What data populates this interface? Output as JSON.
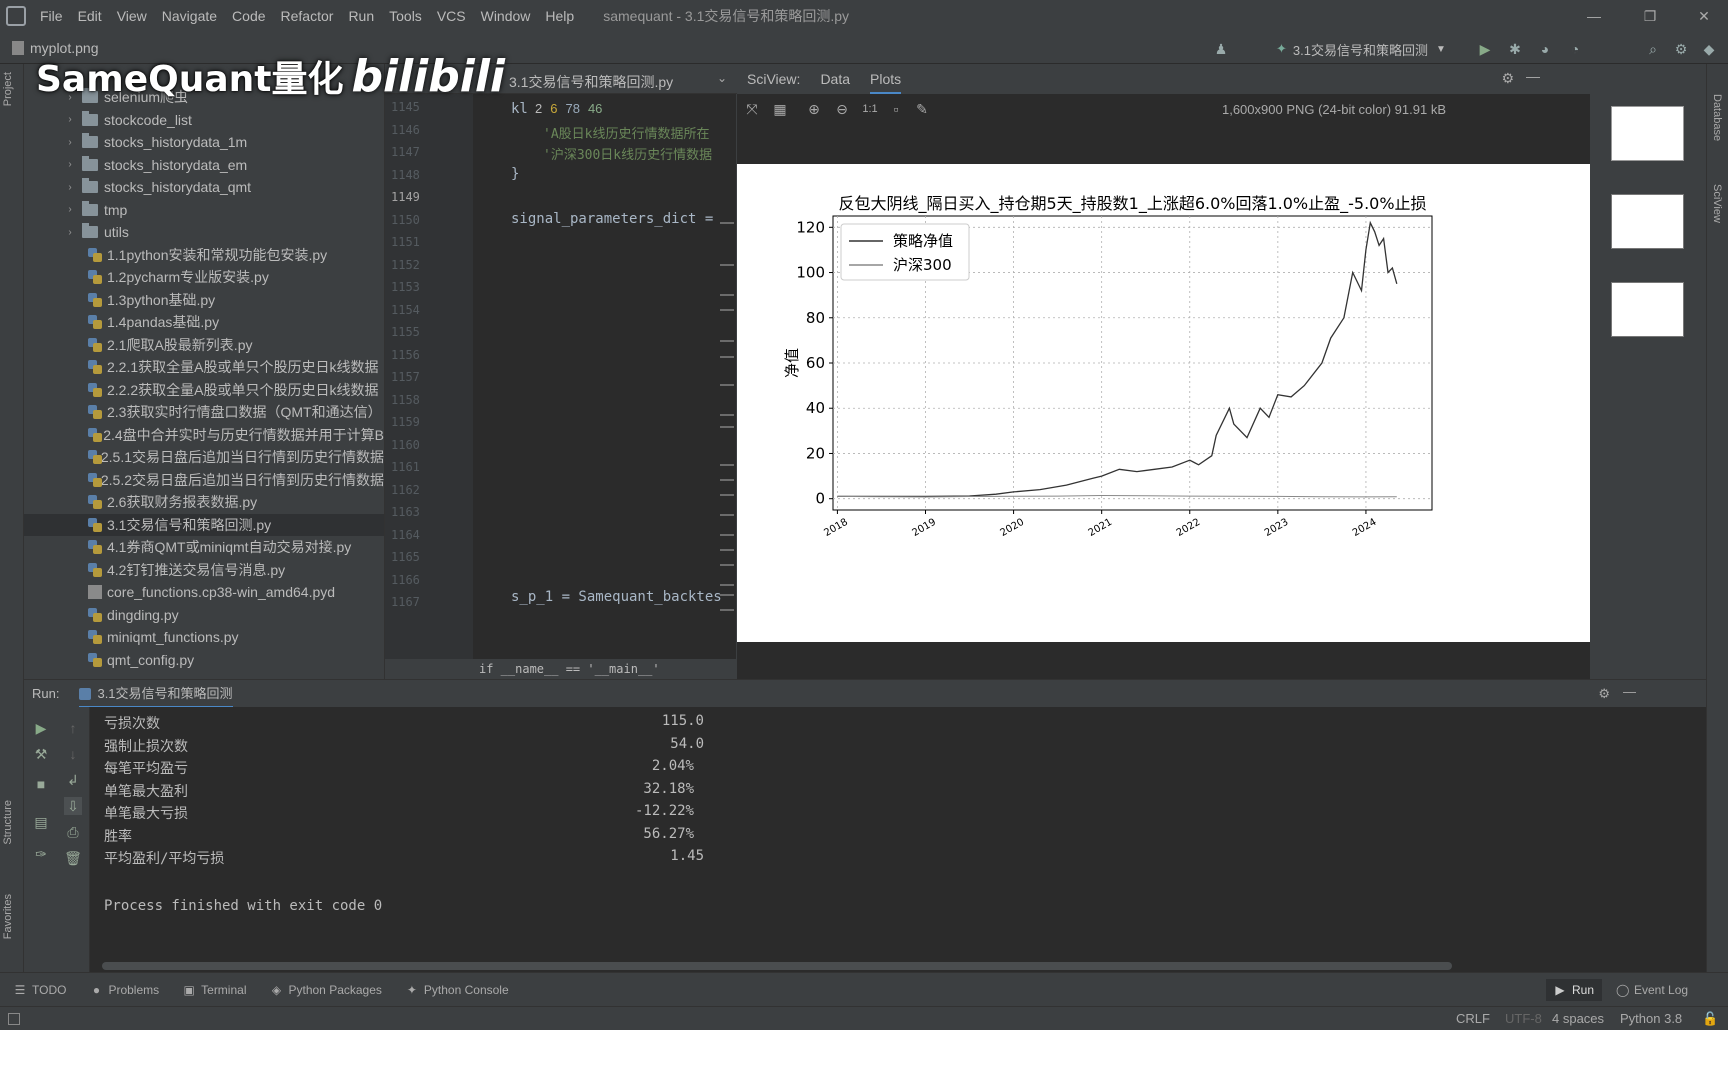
{
  "menubar": {
    "items": [
      "File",
      "Edit",
      "View",
      "Navigate",
      "Code",
      "Refactor",
      "Run",
      "Tools",
      "VCS",
      "Window",
      "Help"
    ],
    "window_title": "samequant - 3.1交易信号和策略回测.py"
  },
  "navbar": {
    "file": "myplot.png",
    "run_config": "3.1交易信号和策略回测"
  },
  "watermark": {
    "brand": "SameQuant量化",
    "site": "bilibili"
  },
  "left_strip": {
    "project": "Project",
    "structure": "Structure",
    "favorites": "Favorites"
  },
  "right_strip": {
    "database": "Database",
    "sciview": "SciView"
  },
  "project_tree": [
    {
      "type": "folder",
      "label": "selenium爬虫"
    },
    {
      "type": "folder",
      "label": "stockcode_list"
    },
    {
      "type": "folder",
      "label": "stocks_historydata_1m"
    },
    {
      "type": "folder",
      "label": "stocks_historydata_em"
    },
    {
      "type": "folder",
      "label": "stocks_historydata_qmt"
    },
    {
      "type": "folder",
      "label": "tmp"
    },
    {
      "type": "folder",
      "label": "utils"
    },
    {
      "type": "py",
      "label": "1.1python安装和常规功能包安装.py"
    },
    {
      "type": "py",
      "label": "1.2pycharm专业版安装.py"
    },
    {
      "type": "py",
      "label": "1.3python基础.py"
    },
    {
      "type": "py",
      "label": "1.4pandas基础.py"
    },
    {
      "type": "py",
      "label": "2.1爬取A股最新列表.py"
    },
    {
      "type": "py",
      "label": "2.2.1获取全量A股或单只个股历史日k线数据"
    },
    {
      "type": "py",
      "label": "2.2.2获取全量A股或单只个股历史日k线数据"
    },
    {
      "type": "py",
      "label": "2.3获取实时行情盘口数据（QMT和通达信）"
    },
    {
      "type": "py",
      "label": "2.4盘中合并实时与历史行情数据并用于计算B"
    },
    {
      "type": "py",
      "label": "2.5.1交易日盘后追加当日行情到历史行情数据"
    },
    {
      "type": "py",
      "label": "2.5.2交易日盘后追加当日行情到历史行情数据"
    },
    {
      "type": "py",
      "label": "2.6获取财务报表数据.py"
    },
    {
      "type": "py",
      "label": "3.1交易信号和策略回测.py",
      "selected": true
    },
    {
      "type": "py",
      "label": "4.1券商QMT或miniqmt自动交易对接.py"
    },
    {
      "type": "py",
      "label": "4.2钉钉推送交易信号消息.py"
    },
    {
      "type": "pyd",
      "label": "core_functions.cp38-win_amd64.pyd"
    },
    {
      "type": "py",
      "label": "dingding.py"
    },
    {
      "type": "py",
      "label": "miniqmt_functions.py"
    },
    {
      "type": "py",
      "label": "qmt_config.py"
    }
  ],
  "editor": {
    "tab": "3.1交易信号和策略回测.py",
    "inspection": {
      "warn": "2",
      "weak": "6",
      "typo": "78",
      "check": "46"
    },
    "lines": [
      "1145",
      "1146",
      "1147",
      "1148",
      "1149",
      "1150",
      "1151",
      "1152",
      "1153",
      "1154",
      "1155",
      "1156",
      "1157",
      "1158",
      "1159",
      "1160",
      "1161",
      "1162",
      "1163",
      "1164",
      "1165",
      "1166",
      "1167"
    ],
    "code_kl": "kl",
    "code_str1": "'A股日k线历史行情数据所在",
    "code_str2": "'沪深300日k线历史行情数据",
    "code_brace": "}",
    "code_signal": "signal_parameters_dict =",
    "code_sp": "s_p_1 = Samequant_backtes",
    "breadcrumb": "if __name__ == '__main__'"
  },
  "sciview": {
    "title": "SciView:",
    "tabs": [
      "Data",
      "Plots"
    ],
    "zoom_label": "1:1",
    "image_info": "1,600x900 PNG (24-bit color) 91.91 kB"
  },
  "chart_data": {
    "type": "line",
    "title": "反包大阴线_隔日买入_持仓期5天_持股数1_上涨超6.0%回落1.0%止盈_-5.0%止损",
    "xlabel": "",
    "ylabel": "净值",
    "ylim": [
      -5,
      125
    ],
    "xlim": [
      2017.95,
      2024.75
    ],
    "x_ticks": [
      "2018",
      "2019",
      "2020",
      "2021",
      "2022",
      "2023",
      "2024"
    ],
    "y_ticks": [
      0,
      20,
      40,
      60,
      80,
      100,
      120
    ],
    "grid": true,
    "legend_position": "upper-left",
    "colors": {
      "strategy": "#333333",
      "hs300": "#888888"
    },
    "series": [
      {
        "name": "策略净值",
        "x": [
          2018.0,
          2018.5,
          2019.0,
          2019.5,
          2019.8,
          2020.0,
          2020.3,
          2020.6,
          2020.9,
          2021.0,
          2021.2,
          2021.4,
          2021.6,
          2021.8,
          2022.0,
          2022.05,
          2022.1,
          2022.25,
          2022.3,
          2022.45,
          2022.5,
          2022.65,
          2022.8,
          2022.9,
          2023.0,
          2023.15,
          2023.3,
          2023.5,
          2023.6,
          2023.75,
          2023.85,
          2023.95,
          2024.0,
          2024.05,
          2024.1,
          2024.15,
          2024.2,
          2024.25,
          2024.3,
          2024.35
        ],
        "y": [
          1,
          1,
          1,
          1.2,
          2,
          3,
          4,
          6,
          9,
          10,
          13,
          12,
          13,
          14,
          17,
          16,
          15,
          19,
          28,
          40,
          33,
          27,
          40,
          36,
          46,
          45,
          50,
          60,
          71,
          80,
          100,
          92,
          110,
          122,
          118,
          112,
          115,
          100,
          102,
          95
        ]
      },
      {
        "name": "沪深300",
        "x": [
          2018.0,
          2018.5,
          2019.0,
          2019.5,
          2020.0,
          2020.5,
          2021.0,
          2021.5,
          2022.0,
          2022.5,
          2023.0,
          2023.5,
          2024.0,
          2024.35
        ],
        "y": [
          1,
          0.9,
          0.75,
          0.95,
          1.05,
          1.15,
          1.4,
          1.3,
          1.15,
          1.05,
          1.0,
          0.9,
          0.8,
          0.9
        ]
      }
    ]
  },
  "run_panel": {
    "label": "Run:",
    "tab": "3.1交易信号和策略回测",
    "output": [
      {
        "k": "亏损次数",
        "v": "115.0"
      },
      {
        "k": "强制止损次数",
        "v": "54.0"
      },
      {
        "k": "每笔平均盈亏",
        "v": "2.04%"
      },
      {
        "k": "单笔最大盈利",
        "v": "32.18%"
      },
      {
        "k": "单笔最大亏损",
        "v": "-12.22%"
      },
      {
        "k": "胜率",
        "v": "56.27%"
      },
      {
        "k": "平均盈利/平均亏损",
        "v": "1.45"
      }
    ],
    "exit": "Process finished with exit code 0"
  },
  "bottom_tools": [
    "TODO",
    "Problems",
    "Terminal",
    "Python Packages",
    "Python Console"
  ],
  "bottom_right": {
    "run": "Run",
    "event_log": "Event Log"
  },
  "status": {
    "line_sep": "CRLF",
    "encoding": "UTF-8",
    "indent": "4 spaces",
    "interpreter": "Python 3.8"
  }
}
